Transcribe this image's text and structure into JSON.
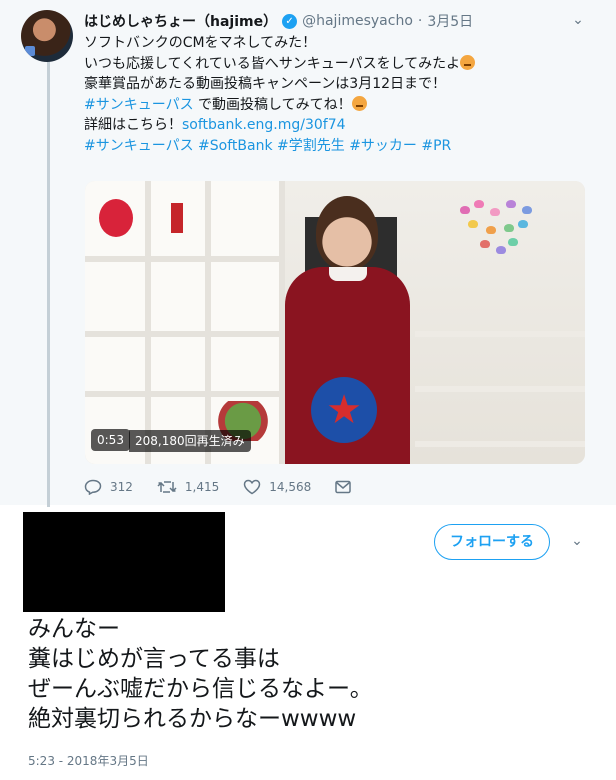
{
  "quoted_tweet": {
    "display_name": "はじめしゃちょー（hajime）",
    "handle": "@hajimesyacho",
    "separator": "·",
    "date": "3月5日",
    "caret": "⌄",
    "lines": [
      "ソフトバンクのCMをマネしてみた！",
      "いつも応援してくれている皆へサンキューパスをしてみたよ",
      "豪華賞品があたる動画投稿キャンペーンは3月12日まで！"
    ],
    "hashtag_line": {
      "tag": "#サンキューパス",
      "rest": " で動画投稿してみてね！"
    },
    "details_line": {
      "prefix": "詳細はこちら！",
      "link": "softbank.eng.mg/30f74"
    },
    "hashtags": "#サンキューパス #SoftBank #学割先生 #サッカー #PR",
    "video": {
      "duration": "0:53",
      "views": "208,180回再生済み"
    },
    "actions": {
      "replies": "312",
      "retweets": "1,415",
      "likes": "14,568"
    }
  },
  "main_tweet": {
    "follow_label": "フォローする",
    "caret": "⌄",
    "lines": [
      "みんなー",
      "糞はじめが言ってる事は",
      "ぜーんぶ嘘だから信じるなよー。",
      "絶対裏切られるからなーwwww"
    ],
    "timestamp": "5:23 - 2018年3月5日"
  },
  "colors": {
    "accent": "#1da1f2",
    "muted": "#657786",
    "quoted_bg": "#f5f8fa"
  }
}
